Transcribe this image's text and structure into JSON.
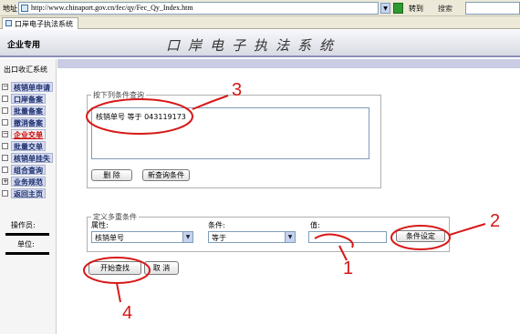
{
  "browser": {
    "address_label": "地址",
    "url": "http://www.chinaport.gov.cn/fec/qy/Fec_Qy_Index.htm",
    "go_label": "转到",
    "search_label": "搜索",
    "tab_title": "口岸电子执法系统"
  },
  "header": {
    "enterprise_label": "企业专用",
    "system_title": "口岸电子执法系统"
  },
  "sidebar": {
    "system_name": "出口收汇系统",
    "items": [
      {
        "label": "核销单申请",
        "marker": "minus"
      },
      {
        "label": "口岸备案",
        "marker": "plain"
      },
      {
        "label": "批量备案",
        "marker": "plain"
      },
      {
        "label": "撤消备案",
        "marker": "plain"
      },
      {
        "label": "企业交单",
        "marker": "minus"
      },
      {
        "label": "批量交单",
        "marker": "plain"
      },
      {
        "label": "核销单挂失",
        "marker": "plain"
      },
      {
        "label": "组合查询",
        "marker": "plain"
      },
      {
        "label": "业务规范",
        "marker": "plus"
      },
      {
        "label": "返回主页",
        "marker": "plain"
      }
    ],
    "active_index": 4,
    "operator_label": "操作员:",
    "unit_label": "单位:"
  },
  "query": {
    "legend": "按下列条件查询",
    "criteria_text": "核销单号  等于  043119173",
    "delete_button": "删  除",
    "new_query_button": "新查询条件"
  },
  "multi": {
    "legend": "定义多重条件",
    "attribute_label": "属性:",
    "attribute_value": "核销单号",
    "condition_label": "条件:",
    "condition_value": "等于",
    "value_label": "值:",
    "value_input": "",
    "set_button": "条件设定"
  },
  "actions": {
    "start_button": "开始查找",
    "cancel_button": "取  消"
  },
  "annotations": {
    "color": "#d81818",
    "labels": [
      "1",
      "2",
      "3",
      "4"
    ]
  }
}
